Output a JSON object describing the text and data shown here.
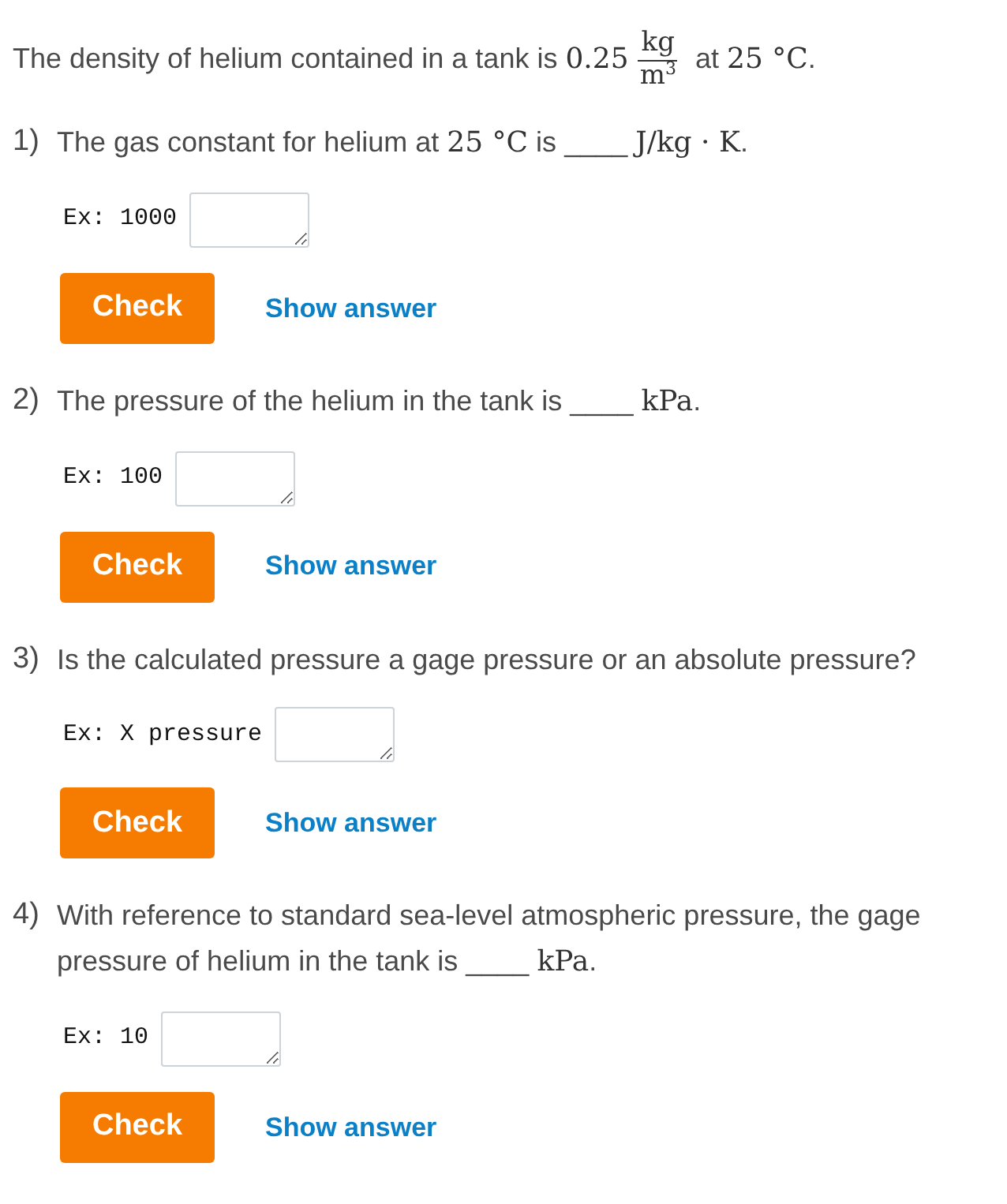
{
  "intro": [
    {
      "kind": "text",
      "text": "The density of helium contained in a tank is "
    },
    {
      "kind": "math",
      "text": "0.25"
    },
    {
      "kind": "fraction",
      "numerator": "kg",
      "denominator": "m$^{3}$"
    },
    {
      "kind": "text",
      "text": " at "
    },
    {
      "kind": "math",
      "text": "25 °C"
    },
    {
      "kind": "text",
      "text": "."
    }
  ],
  "questions": [
    {
      "number": "1)",
      "prompt": [
        {
          "kind": "text",
          "text": "The gas constant for helium at "
        },
        {
          "kind": "math",
          "text": "25 °C"
        },
        {
          "kind": "text",
          "text": " is "
        },
        {
          "kind": "blank",
          "text": "____"
        },
        {
          "kind": "math",
          "text": "J/kg · K"
        },
        {
          "kind": "text",
          "text": "."
        }
      ],
      "example": "Ex: 1000",
      "check": "Check",
      "show_answer": "Show answer"
    },
    {
      "number": "2)",
      "prompt": [
        {
          "kind": "text",
          "text": "The pressure of the helium in the tank is "
        },
        {
          "kind": "blank",
          "text": "____"
        },
        {
          "kind": "math",
          "text": "kPa"
        },
        {
          "kind": "text",
          "text": "."
        }
      ],
      "example": "Ex: 100",
      "check": "Check",
      "show_answer": "Show answer"
    },
    {
      "number": "3)",
      "prompt": [
        {
          "kind": "text",
          "text": "Is the calculated pressure a gage pressure or an absolute pressure?"
        }
      ],
      "example": "Ex: X pressure",
      "check": "Check",
      "show_answer": "Show answer"
    },
    {
      "number": "4)",
      "prompt": [
        {
          "kind": "text",
          "text": "With reference to standard sea-level atmospheric pressure, the gage pressure of helium in the tank is "
        },
        {
          "kind": "blank",
          "text": "____"
        },
        {
          "kind": "math",
          "text": "kPa"
        },
        {
          "kind": "text",
          "text": "."
        }
      ],
      "example": "Ex: 10",
      "check": "Check",
      "show_answer": "Show answer"
    }
  ]
}
